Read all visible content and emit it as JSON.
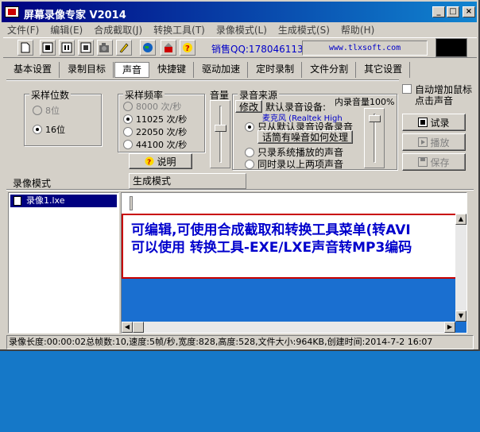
{
  "window": {
    "title": "屏幕录像专家  V2014",
    "minimize": "_",
    "maximize": "□",
    "close": "×"
  },
  "menu": [
    "文件(F)",
    "编辑(E)",
    "合成截取(J)",
    "转换工具(T)",
    "录像模式(L)",
    "生成模式(S)",
    "帮助(H)"
  ],
  "toolbar": {
    "sales": "销售QQ:178046113",
    "url": "www.tlxsoft.com",
    "icons": [
      "new-file-icon",
      "record-icon",
      "pause-icon",
      "stop-icon",
      "camera-icon",
      "pen-icon",
      "globe-icon",
      "wizard-icon",
      "help-icon"
    ]
  },
  "tabs": [
    "基本设置",
    "录制目标",
    "声音",
    "快捷键",
    "驱动加速",
    "定时录制",
    "文件分割",
    "其它设置"
  ],
  "bits": {
    "legend": "采样位数",
    "opt8": "8位",
    "opt16": "16位"
  },
  "rate": {
    "legend": "采样频率",
    "opts": [
      "8000 次/秒",
      "11025 次/秒",
      "22050 次/秒",
      "44100 次/秒"
    ],
    "explain": "说明"
  },
  "volume": {
    "legend": "音量",
    "level": 0.6
  },
  "source": {
    "legend": "录音来源",
    "edit": "修改",
    "default_label": "默认录音设备:",
    "device": "麦克风 (Realtek High",
    "internal": "内录音量100%",
    "only_default": "只从默认录音设备录音",
    "noise_help": "话筒有噪音如何处理",
    "only_system": "只录系统播放的声音",
    "both": "同时录以上两项声音"
  },
  "right": {
    "auto_click": "自动增加鼠标点击声音",
    "audition": "试录",
    "play": "播放",
    "save": "保存"
  },
  "modes": {
    "record": "录像模式",
    "generate": "生成模式"
  },
  "list": {
    "item": "录像1.lxe"
  },
  "info": {
    "line1": "可编辑,可使用合成截取和转换工具菜单(转AVI",
    "line2": "可以使用 转换工具-EXE/LXE声音转MP3编码"
  },
  "status": "录像长度:00:00:02总帧数:10,速度:5帧/秒,宽度:828,高度:528,文件大小:964KB,创建时间:2014-7-2  16:07"
}
